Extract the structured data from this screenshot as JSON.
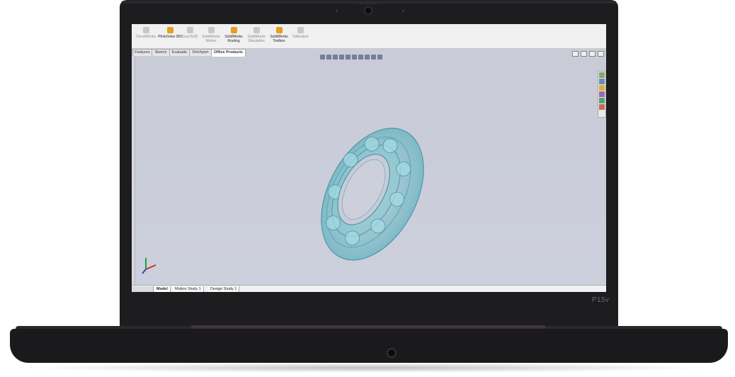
{
  "device": {
    "model_label": "P15v"
  },
  "ribbon": {
    "items": [
      {
        "label": "CircuitWorks",
        "active": false
      },
      {
        "label": "PhotoView 360",
        "active": true
      },
      {
        "label": "ScanTo3D",
        "active": false
      },
      {
        "label": "SolidWorks Motion",
        "active": false
      },
      {
        "label": "SolidWorks Routing",
        "active": true
      },
      {
        "label": "SolidWorks Simulation",
        "active": false
      },
      {
        "label": "SolidWorks Toolbox",
        "active": true
      },
      {
        "label": "TolAnalyst",
        "active": false
      }
    ]
  },
  "tabs": [
    {
      "label": "Features"
    },
    {
      "label": "Sketch"
    },
    {
      "label": "Evaluate"
    },
    {
      "label": "DimXpert"
    },
    {
      "label": "Office Products",
      "active": true
    }
  ],
  "status_tabs": [
    {
      "label": "Model"
    },
    {
      "label": "Motion Study 1"
    },
    {
      "label": "Design Study 1"
    }
  ],
  "colors": {
    "viewport_bg": "#c9cbd7",
    "bearing": "#7ec4cf",
    "bezel": "#1d1d1f"
  },
  "viewport": {
    "part": "ball-bearing"
  }
}
